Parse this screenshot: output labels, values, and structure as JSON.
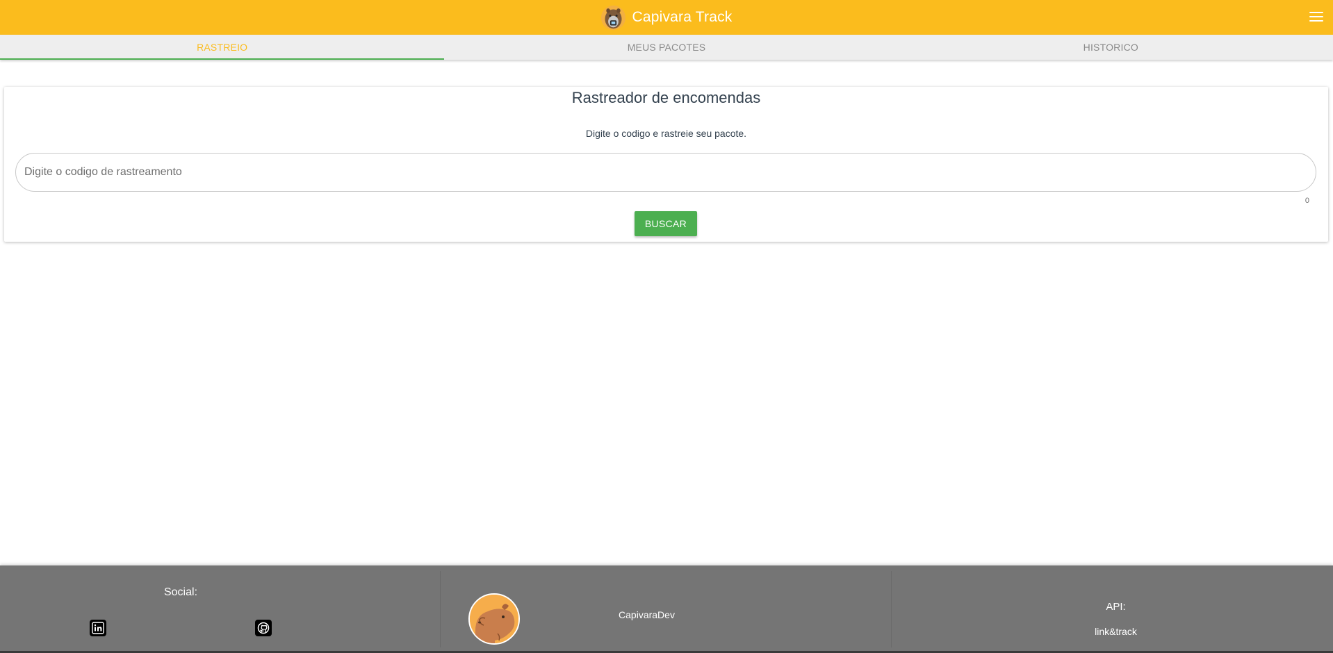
{
  "header": {
    "title": "Capivara Track",
    "logo_icon": "capybara-logo-icon",
    "menu_icon": "hamburger-menu-icon",
    "background": "#fbbc1d"
  },
  "tabs": [
    {
      "label": "RASTREIO",
      "active": true
    },
    {
      "label": "MEUS PACOTES",
      "active": false
    },
    {
      "label": "HISTORICO",
      "active": false
    }
  ],
  "tracker": {
    "title": "Rastreador de encomendas",
    "subtitle": "Digite o codigo e rastreie seu pacote.",
    "input_placeholder": "Digite o codigo de rastreamento",
    "input_value": "",
    "char_count": "0",
    "search_label": "BUSCAR",
    "accent": "#4caf50"
  },
  "footer": {
    "social_title": "Social:",
    "social_icons": [
      "linkedin-icon",
      "github-icon"
    ],
    "dev_name": "CapivaraDev",
    "dev_avatar_icon": "capybara-avatar",
    "api_title": "API:",
    "api_link": "link&track",
    "background": "#757575"
  }
}
